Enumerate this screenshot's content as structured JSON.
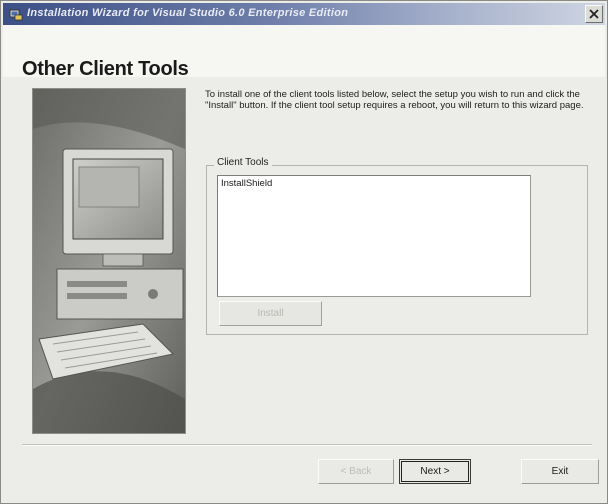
{
  "window": {
    "title": "Installation Wizard for Visual Studio 6.0 Enterprise Edition"
  },
  "page": {
    "title": "Other Client Tools",
    "intro": "To install one of the client tools listed below, select the setup you wish to run and click the \"Install\" button. If the client tool setup requires a reboot, you will return to this wizard page."
  },
  "client_tools": {
    "group_label": "Client Tools",
    "items": [
      "InstallShield"
    ],
    "install_label": "Install"
  },
  "buttons": {
    "back_label": "< Back",
    "next_label": "Next >",
    "exit_label": "Exit"
  }
}
